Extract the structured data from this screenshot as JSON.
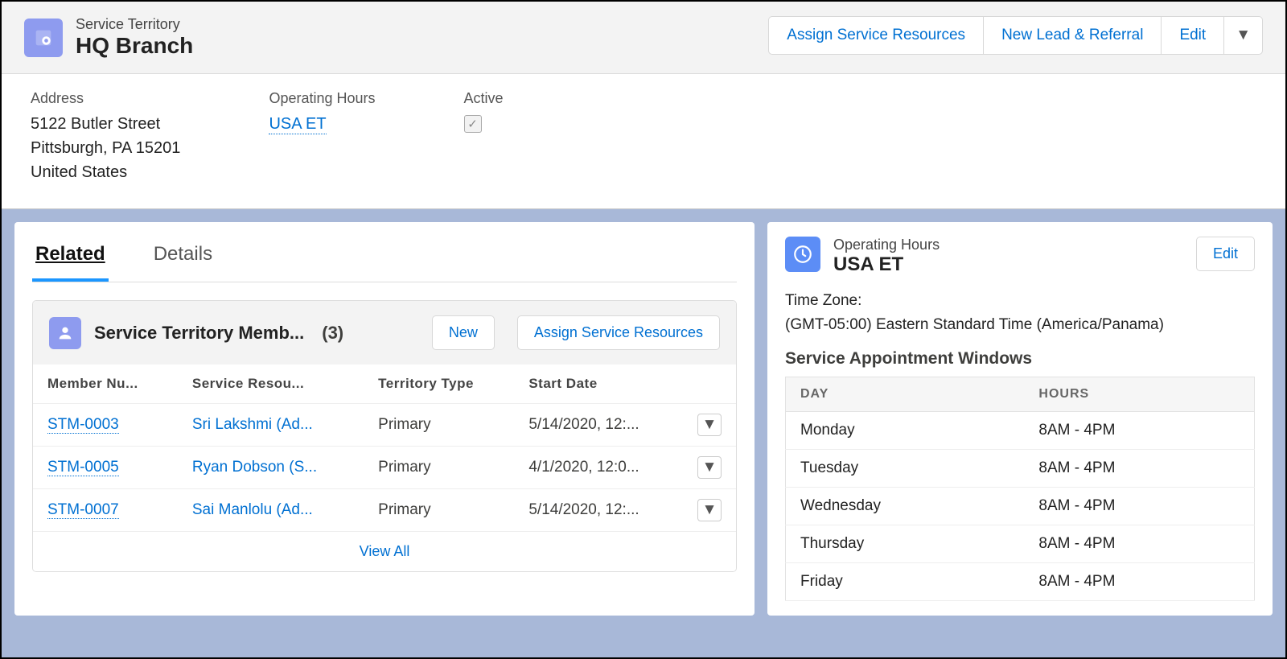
{
  "header": {
    "object_label": "Service Territory",
    "record_name": "HQ Branch",
    "actions": {
      "assign_resources": "Assign Service Resources",
      "new_lead_referral": "New Lead & Referral",
      "edit": "Edit"
    }
  },
  "highlights": {
    "address_label": "Address",
    "address_line1": "5122 Butler Street",
    "address_line2": "Pittsburgh, PA 15201",
    "address_line3": "United States",
    "op_hours_label": "Operating Hours",
    "op_hours_value": "USA ET",
    "active_label": "Active",
    "active_checked": true
  },
  "tabs": {
    "related": "Related",
    "details": "Details",
    "active": "related"
  },
  "related_card": {
    "title": "Service Territory Memb...",
    "count": "(3)",
    "btn_new": "New",
    "btn_assign": "Assign Service Resources",
    "columns": {
      "member_num": "Member Nu...",
      "service_resource": "Service Resou...",
      "territory_type": "Territory Type",
      "start_date": "Start Date"
    },
    "rows": [
      {
        "member": "STM-0003",
        "resource": "Sri Lakshmi (Ad...",
        "type": "Primary",
        "start": "5/14/2020, 12:..."
      },
      {
        "member": "STM-0005",
        "resource": "Ryan Dobson (S...",
        "type": "Primary",
        "start": "4/1/2020, 12:0..."
      },
      {
        "member": "STM-0007",
        "resource": "Sai Manlolu (Ad...",
        "type": "Primary",
        "start": "5/14/2020, 12:..."
      }
    ],
    "view_all": "View All"
  },
  "right_panel": {
    "object_label": "Operating Hours",
    "record_name": "USA ET",
    "edit": "Edit",
    "tz_label": "Time Zone:",
    "tz_value": "(GMT-05:00) Eastern Standard Time (America/Panama)",
    "saw_title": "Service Appointment Windows",
    "columns": {
      "day": "DAY",
      "hours": "HOURS"
    },
    "rows": [
      {
        "day": "Monday",
        "hours": "8AM - 4PM"
      },
      {
        "day": "Tuesday",
        "hours": "8AM - 4PM"
      },
      {
        "day": "Wednesday",
        "hours": "8AM - 4PM"
      },
      {
        "day": "Thursday",
        "hours": "8AM - 4PM"
      },
      {
        "day": "Friday",
        "hours": "8AM - 4PM"
      }
    ]
  }
}
